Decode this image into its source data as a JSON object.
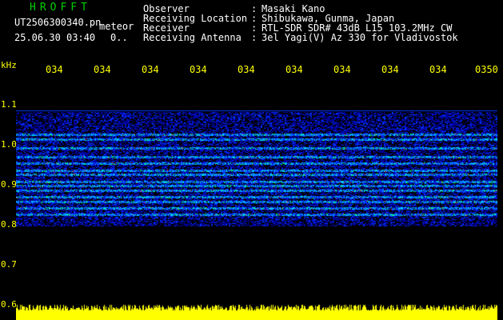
{
  "header": {
    "brand": "HROFFT",
    "filename": "UT2506300340.pn",
    "mode": "meteor",
    "datetime": "25.06.30 03:40",
    "level": "0..",
    "fields": [
      {
        "label": "Observer",
        "value": "Masaki Kano"
      },
      {
        "label": "Receiving Location",
        "value": "Shibukawa, Gunma, Japan"
      },
      {
        "label": "Receiver",
        "value": "RTL-SDR SDR# 43dB L15 103.2MHz CW"
      },
      {
        "label": "Receiving Antenna",
        "value": "3el Yagi(V) Az 330 for Vladivostok"
      }
    ],
    "separator": ":"
  },
  "axes": {
    "unit": "kHz",
    "y_ticks": [
      "1.1",
      "1.0",
      "0.9",
      "0.8",
      "0.7",
      "0.6"
    ],
    "x_ticks": [
      "034",
      "034",
      "034",
      "034",
      "034",
      "034",
      "034",
      "034",
      "034",
      "0350"
    ]
  },
  "spectrogram": {
    "y_range_khz": [
      0.6,
      1.13
    ],
    "bands_khz": [
      0.995,
      0.985,
      0.965,
      0.945,
      0.93,
      0.915,
      0.905,
      0.89,
      0.88,
      0.87,
      0.855,
      0.845,
      0.83,
      0.815
    ],
    "noise_floor_level": 0.25,
    "colors": {
      "background": "#000000",
      "noise": "#0000a0",
      "low": "#0030ff",
      "mid": "#00c8ff",
      "high": "#00ff60",
      "peak": "#ff3000",
      "power_trace": "#ffff00"
    }
  }
}
